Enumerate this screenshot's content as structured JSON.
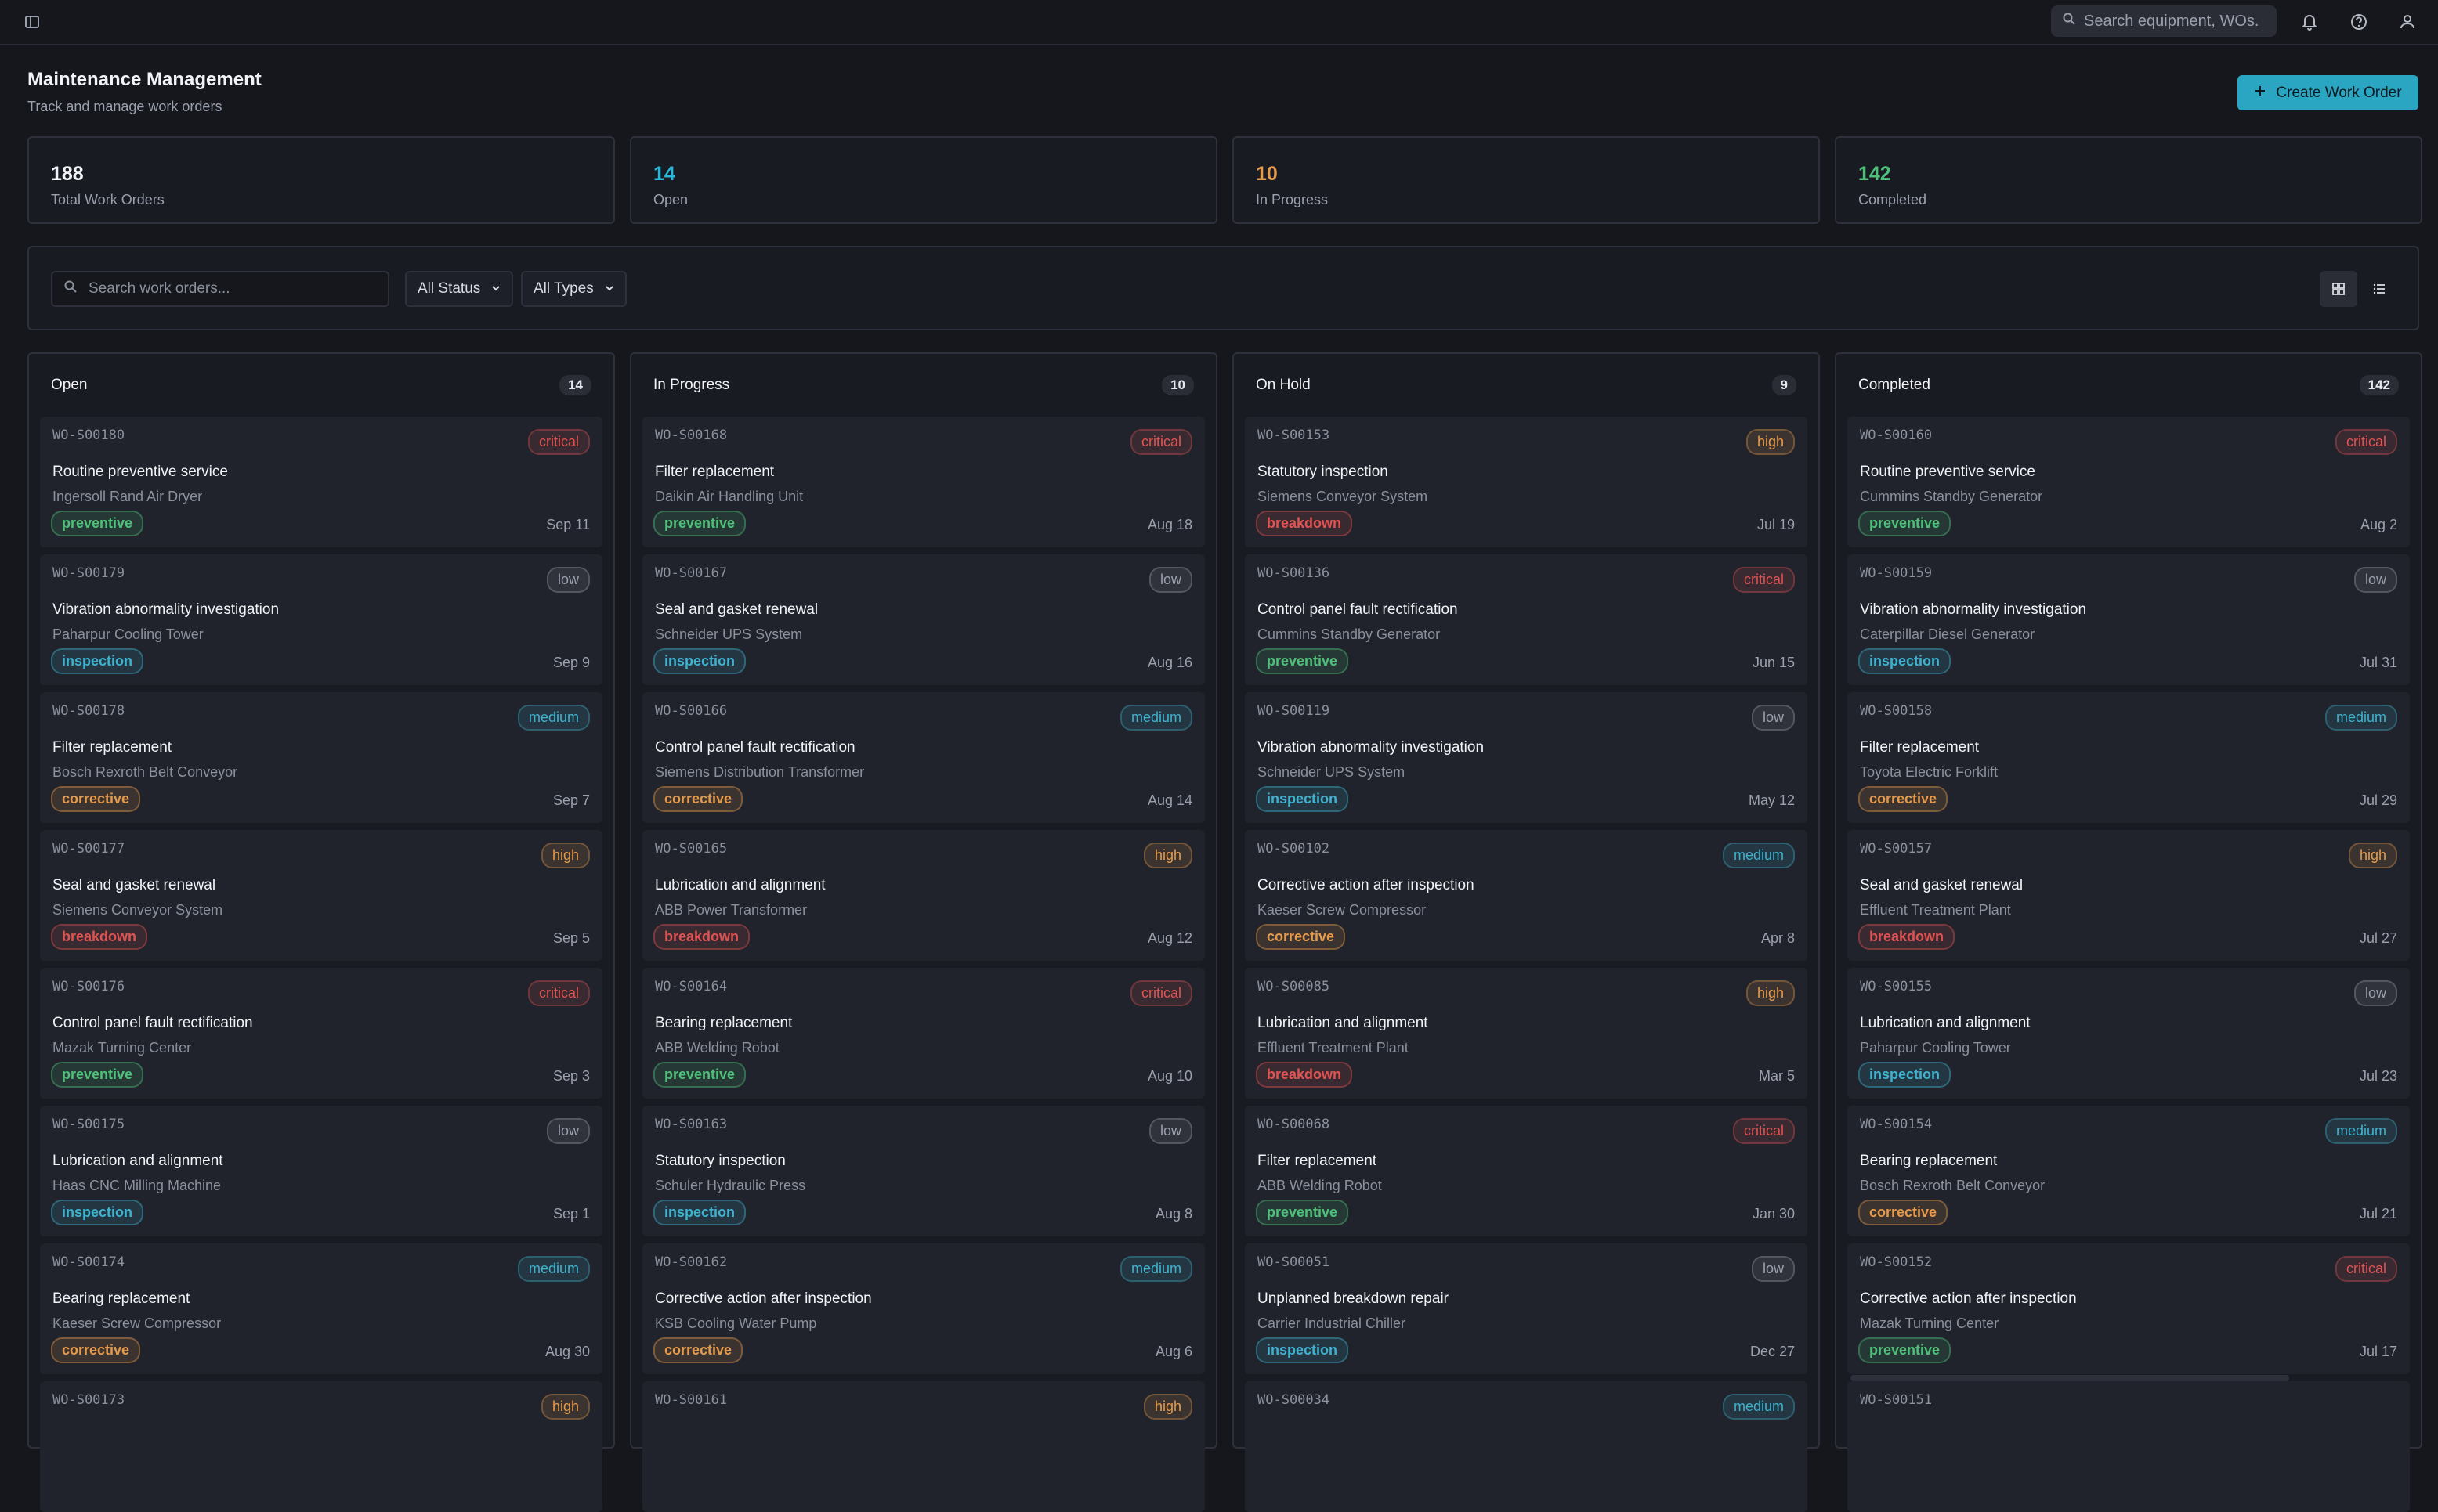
{
  "colors": {
    "total": "#f1f3f7",
    "open": "#2bb5d6",
    "in_progress": "#e69a4c",
    "completed": "#4fc07a",
    "critical": "#e05353",
    "high": "#e69a4c",
    "medium": "#3fb2cf",
    "low": "#9aa0ad",
    "preventive": "#4fc07a",
    "inspection": "#3fb2cf",
    "corrective": "#e69a4c",
    "breakdown": "#e05353"
  },
  "topbar": {
    "sidebar_icon": "sidebar-toggle-icon",
    "search_placeholder": "Search equipment, WOs.",
    "icons": [
      "bell-icon",
      "help-icon",
      "user-icon"
    ]
  },
  "header": {
    "title": "Maintenance Management",
    "subtitle": "Track and manage work orders",
    "create_label": "Create Work Order"
  },
  "stats": [
    {
      "value": "188",
      "label": "Total Work Orders",
      "color": "#f1f3f7"
    },
    {
      "value": "14",
      "label": "Open",
      "color": "#2bb5d6"
    },
    {
      "value": "10",
      "label": "In Progress",
      "color": "#e69a4c"
    },
    {
      "value": "142",
      "label": "Completed",
      "color": "#4fc07a"
    }
  ],
  "filters": {
    "search_placeholder": "Search work orders...",
    "status_select": "All Status",
    "type_select": "All Types",
    "view_modes": [
      "grid",
      "list"
    ],
    "active_view": "grid"
  },
  "columns": [
    {
      "title": "Open",
      "count": "14",
      "cards": [
        {
          "id": "WO-S00180",
          "priority": "critical",
          "title": "Routine preventive service",
          "asset": "Ingersoll Rand Air Dryer",
          "type": "preventive",
          "date": "Sep 11"
        },
        {
          "id": "WO-S00179",
          "priority": "low",
          "title": "Vibration abnormality investigation",
          "asset": "Paharpur Cooling Tower",
          "type": "inspection",
          "date": "Sep 9"
        },
        {
          "id": "WO-S00178",
          "priority": "medium",
          "title": "Filter replacement",
          "asset": "Bosch Rexroth Belt Conveyor",
          "type": "corrective",
          "date": "Sep 7"
        },
        {
          "id": "WO-S00177",
          "priority": "high",
          "title": "Seal and gasket renewal",
          "asset": "Siemens Conveyor System",
          "type": "breakdown",
          "date": "Sep 5"
        },
        {
          "id": "WO-S00176",
          "priority": "critical",
          "title": "Control panel fault rectification",
          "asset": "Mazak Turning Center",
          "type": "preventive",
          "date": "Sep 3"
        },
        {
          "id": "WO-S00175",
          "priority": "low",
          "title": "Lubrication and alignment",
          "asset": "Haas CNC Milling Machine",
          "type": "inspection",
          "date": "Sep 1"
        },
        {
          "id": "WO-S00174",
          "priority": "medium",
          "title": "Bearing replacement",
          "asset": "Kaeser Screw Compressor",
          "type": "corrective",
          "date": "Aug 30"
        },
        {
          "id": "WO-S00173",
          "priority": "high",
          "title": "",
          "asset": "",
          "type": "",
          "date": ""
        }
      ]
    },
    {
      "title": "In Progress",
      "count": "10",
      "cards": [
        {
          "id": "WO-S00168",
          "priority": "critical",
          "title": "Filter replacement",
          "asset": "Daikin Air Handling Unit",
          "type": "preventive",
          "date": "Aug 18"
        },
        {
          "id": "WO-S00167",
          "priority": "low",
          "title": "Seal and gasket renewal",
          "asset": "Schneider UPS System",
          "type": "inspection",
          "date": "Aug 16"
        },
        {
          "id": "WO-S00166",
          "priority": "medium",
          "title": "Control panel fault rectification",
          "asset": "Siemens Distribution Transformer",
          "type": "corrective",
          "date": "Aug 14"
        },
        {
          "id": "WO-S00165",
          "priority": "high",
          "title": "Lubrication and alignment",
          "asset": "ABB Power Transformer",
          "type": "breakdown",
          "date": "Aug 12"
        },
        {
          "id": "WO-S00164",
          "priority": "critical",
          "title": "Bearing replacement",
          "asset": "ABB Welding Robot",
          "type": "preventive",
          "date": "Aug 10"
        },
        {
          "id": "WO-S00163",
          "priority": "low",
          "title": "Statutory inspection",
          "asset": "Schuler Hydraulic Press",
          "type": "inspection",
          "date": "Aug 8"
        },
        {
          "id": "WO-S00162",
          "priority": "medium",
          "title": "Corrective action after inspection",
          "asset": "KSB Cooling Water Pump",
          "type": "corrective",
          "date": "Aug 6"
        },
        {
          "id": "WO-S00161",
          "priority": "high",
          "title": "",
          "asset": "",
          "type": "",
          "date": ""
        }
      ]
    },
    {
      "title": "On Hold",
      "count": "9",
      "cards": [
        {
          "id": "WO-S00153",
          "priority": "high",
          "title": "Statutory inspection",
          "asset": "Siemens Conveyor System",
          "type": "breakdown",
          "date": "Jul 19"
        },
        {
          "id": "WO-S00136",
          "priority": "critical",
          "title": "Control panel fault rectification",
          "asset": "Cummins Standby Generator",
          "type": "preventive",
          "date": "Jun 15"
        },
        {
          "id": "WO-S00119",
          "priority": "low",
          "title": "Vibration abnormality investigation",
          "asset": "Schneider UPS System",
          "type": "inspection",
          "date": "May 12"
        },
        {
          "id": "WO-S00102",
          "priority": "medium",
          "title": "Corrective action after inspection",
          "asset": "Kaeser Screw Compressor",
          "type": "corrective",
          "date": "Apr 8"
        },
        {
          "id": "WO-S00085",
          "priority": "high",
          "title": "Lubrication and alignment",
          "asset": "Effluent Treatment Plant",
          "type": "breakdown",
          "date": "Mar 5"
        },
        {
          "id": "WO-S00068",
          "priority": "critical",
          "title": "Filter replacement",
          "asset": "ABB Welding Robot",
          "type": "preventive",
          "date": "Jan 30"
        },
        {
          "id": "WO-S00051",
          "priority": "low",
          "title": "Unplanned breakdown repair",
          "asset": "Carrier Industrial Chiller",
          "type": "inspection",
          "date": "Dec 27"
        },
        {
          "id": "WO-S00034",
          "priority": "medium",
          "title": "",
          "asset": "",
          "type": "",
          "date": ""
        }
      ]
    },
    {
      "title": "Completed",
      "count": "142",
      "cards": [
        {
          "id": "WO-S00160",
          "priority": "critical",
          "title": "Routine preventive service",
          "asset": "Cummins Standby Generator",
          "type": "preventive",
          "date": "Aug 2"
        },
        {
          "id": "WO-S00159",
          "priority": "low",
          "title": "Vibration abnormality investigation",
          "asset": "Caterpillar Diesel Generator",
          "type": "inspection",
          "date": "Jul 31"
        },
        {
          "id": "WO-S00158",
          "priority": "medium",
          "title": "Filter replacement",
          "asset": "Toyota Electric Forklift",
          "type": "corrective",
          "date": "Jul 29"
        },
        {
          "id": "WO-S00157",
          "priority": "high",
          "title": "Seal and gasket renewal",
          "asset": "Effluent Treatment Plant",
          "type": "breakdown",
          "date": "Jul 27"
        },
        {
          "id": "WO-S00155",
          "priority": "low",
          "title": "Lubrication and alignment",
          "asset": "Paharpur Cooling Tower",
          "type": "inspection",
          "date": "Jul 23"
        },
        {
          "id": "WO-S00154",
          "priority": "medium",
          "title": "Bearing replacement",
          "asset": "Bosch Rexroth Belt Conveyor",
          "type": "corrective",
          "date": "Jul 21"
        },
        {
          "id": "WO-S00152",
          "priority": "critical",
          "title": "Corrective action after inspection",
          "asset": "Mazak Turning Center",
          "type": "preventive",
          "date": "Jul 17"
        },
        {
          "id": "WO-S00151",
          "priority": "",
          "title": "",
          "asset": "",
          "type": "",
          "date": ""
        }
      ]
    }
  ]
}
